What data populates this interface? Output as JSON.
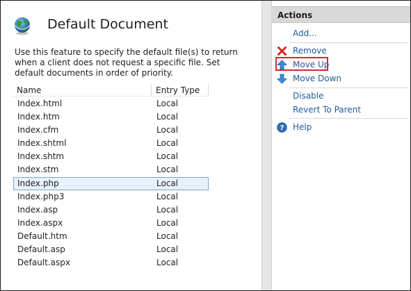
{
  "main": {
    "title": "Default Document",
    "icon": "globe-icon",
    "description": "Use this feature to specify the default file(s) to return when a client does not request a specific file. Set default documents in order of priority.",
    "columns": {
      "name": "Name",
      "entry_type": "Entry Type"
    },
    "rows": [
      {
        "name": "Index.html",
        "type": "Local"
      },
      {
        "name": "Index.htm",
        "type": "Local"
      },
      {
        "name": "Index.cfm",
        "type": "Local"
      },
      {
        "name": "Index.shtml",
        "type": "Local"
      },
      {
        "name": "Index.shtm",
        "type": "Local"
      },
      {
        "name": "Index.stm",
        "type": "Local"
      },
      {
        "name": "Index.php",
        "type": "Local"
      },
      {
        "name": "Index.php3",
        "type": "Local"
      },
      {
        "name": "Index.asp",
        "type": "Local"
      },
      {
        "name": "Index.aspx",
        "type": "Local"
      },
      {
        "name": "Default.htm",
        "type": "Local"
      },
      {
        "name": "Default.asp",
        "type": "Local"
      },
      {
        "name": "Default.aspx",
        "type": "Local"
      }
    ],
    "selected_row": "Index.php"
  },
  "actions": {
    "title": "Actions",
    "items": [
      {
        "label": "Add...",
        "icon": ""
      },
      {
        "label": "Remove",
        "icon": "remove-x-icon"
      },
      {
        "label": "Move Up",
        "icon": "move-up-arrow-icon"
      },
      {
        "label": "Move Down",
        "icon": "move-down-arrow-icon"
      },
      {
        "label": "Disable",
        "icon": ""
      },
      {
        "label": "Revert To Parent",
        "icon": ""
      },
      {
        "label": "Help",
        "icon": "help-icon"
      }
    ],
    "highlighted": "Move Up"
  },
  "colors": {
    "link": "#1f5b9c",
    "selection_bg": "#e8f1fb",
    "selection_border": "#7da2ce",
    "highlight_box": "#d8262c",
    "header_bg": "#d9d9d9"
  }
}
